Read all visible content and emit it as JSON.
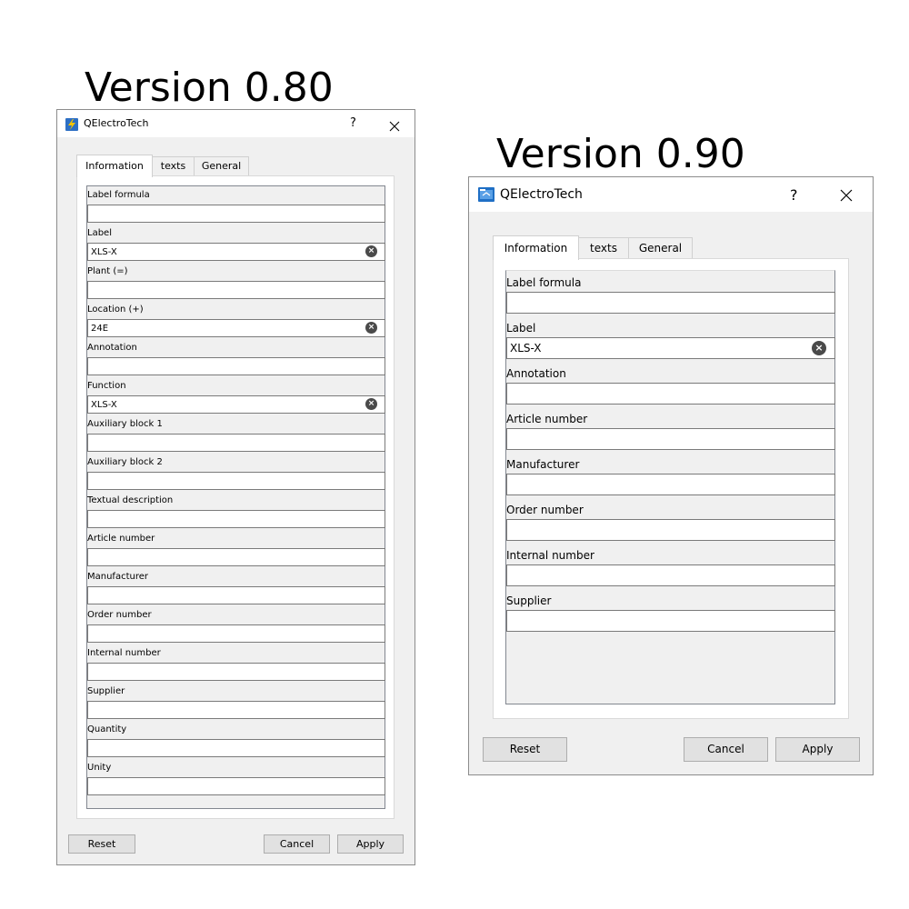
{
  "headings": {
    "old": "Version 0.80",
    "new": "Version 0.90"
  },
  "old_dialog": {
    "title": "QElectroTech",
    "help": "?",
    "icons": {
      "app": "qelectrotech-lightning-icon",
      "close": "close-x-icon",
      "clear": "clear-circle-x-icon"
    },
    "tabs": [
      {
        "label": "Information",
        "active": true
      },
      {
        "label": "texts",
        "active": false
      },
      {
        "label": "General",
        "active": false
      }
    ],
    "fields": [
      {
        "label": "Label formula",
        "value": "",
        "clear": false
      },
      {
        "label": "Label",
        "value": "XLS-X",
        "clear": true
      },
      {
        "label": "Plant (=)",
        "value": "",
        "clear": false
      },
      {
        "label": "Location (+)",
        "value": "24E",
        "clear": true
      },
      {
        "label": "Annotation",
        "value": "",
        "clear": false
      },
      {
        "label": "Function",
        "value": "XLS-X",
        "clear": true
      },
      {
        "label": "Auxiliary block 1",
        "value": "",
        "clear": false
      },
      {
        "label": "Auxiliary block 2",
        "value": "",
        "clear": false
      },
      {
        "label": "Textual description",
        "value": "",
        "clear": false
      },
      {
        "label": "Article number",
        "value": "",
        "clear": false
      },
      {
        "label": "Manufacturer",
        "value": "",
        "clear": false
      },
      {
        "label": "Order number",
        "value": "",
        "clear": false
      },
      {
        "label": "Internal number",
        "value": "",
        "clear": false
      },
      {
        "label": "Supplier",
        "value": "",
        "clear": false
      },
      {
        "label": "Quantity",
        "value": "",
        "clear": false
      },
      {
        "label": "Unity",
        "value": "",
        "clear": false
      }
    ],
    "buttons": {
      "reset": "Reset",
      "cancel": "Cancel",
      "apply": "Apply"
    }
  },
  "new_dialog": {
    "title": "QElectroTech",
    "help": "?",
    "icons": {
      "app": "qelectrotech-folder-icon",
      "close": "close-x-icon",
      "clear": "clear-circle-x-icon"
    },
    "tabs": [
      {
        "label": "Information",
        "active": true
      },
      {
        "label": "texts",
        "active": false
      },
      {
        "label": "General",
        "active": false
      }
    ],
    "fields": [
      {
        "label": "Label formula",
        "value": "",
        "clear": false
      },
      {
        "label": "Label",
        "value": "XLS-X",
        "clear": true
      },
      {
        "label": "Annotation",
        "value": "",
        "clear": false
      },
      {
        "label": "Article number",
        "value": "",
        "clear": false
      },
      {
        "label": "Manufacturer",
        "value": "",
        "clear": false
      },
      {
        "label": "Order number",
        "value": "",
        "clear": false
      },
      {
        "label": "Internal number",
        "value": "",
        "clear": false
      },
      {
        "label": "Supplier",
        "value": "",
        "clear": false
      }
    ],
    "buttons": {
      "reset": "Reset",
      "cancel": "Cancel",
      "apply": "Apply"
    }
  }
}
